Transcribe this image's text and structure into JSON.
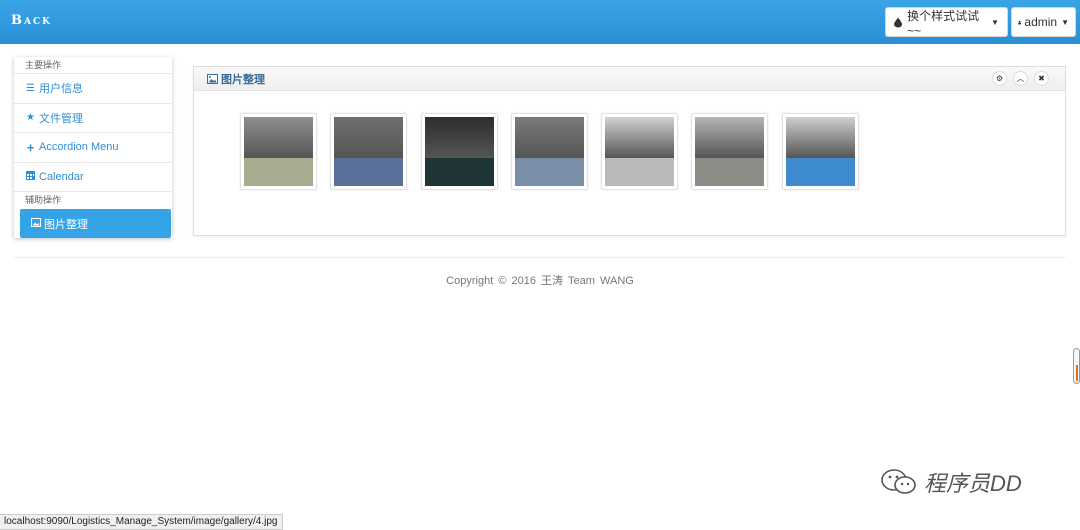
{
  "header": {
    "brand": "Back",
    "style_button": "换个样式试试 ~~",
    "user_button": "admin"
  },
  "sidebar": {
    "group1": "主要操作",
    "items": [
      {
        "label": "用户信息",
        "icon": "list-icon"
      },
      {
        "label": "文件管理",
        "icon": "star-icon"
      },
      {
        "label": "Accordion Menu",
        "icon": "plus-icon"
      },
      {
        "label": "Calendar",
        "icon": "calendar-icon"
      }
    ],
    "group2": "辅助操作",
    "active_item": {
      "label": "图片整理",
      "icon": "picture-icon"
    }
  },
  "panel": {
    "title": "图片整理",
    "tools": [
      "gear-icon",
      "chevron-up-icon",
      "close-icon"
    ]
  },
  "gallery": [
    {
      "top": "#8f8f8f",
      "bottom": "#a9ab90"
    },
    {
      "top": "#6f6f6f",
      "bottom": "#5a6f99"
    },
    {
      "top": "#2b2d30",
      "bottom": "#1f3535"
    },
    {
      "top": "#7a7a7a",
      "bottom": "#7b8ea8"
    },
    {
      "top": "#d2d2d2",
      "bottom": "#b9b9b9"
    },
    {
      "top": "#b4b4b4",
      "bottom": "#8a8c86"
    },
    {
      "top": "#cfcfcf",
      "bottom": "#3e8bd0"
    }
  ],
  "footer": {
    "copyright": "Copyright © 2016 王涛 Team WANG"
  },
  "watermark": "程序员DD",
  "status_url": "localhost:9090/Logistics_Manage_System/image/gallery/4.jpg",
  "colors": {
    "accent": "#36a3e6",
    "topbar": "#2a8fd6",
    "link": "#2f8fd6"
  }
}
